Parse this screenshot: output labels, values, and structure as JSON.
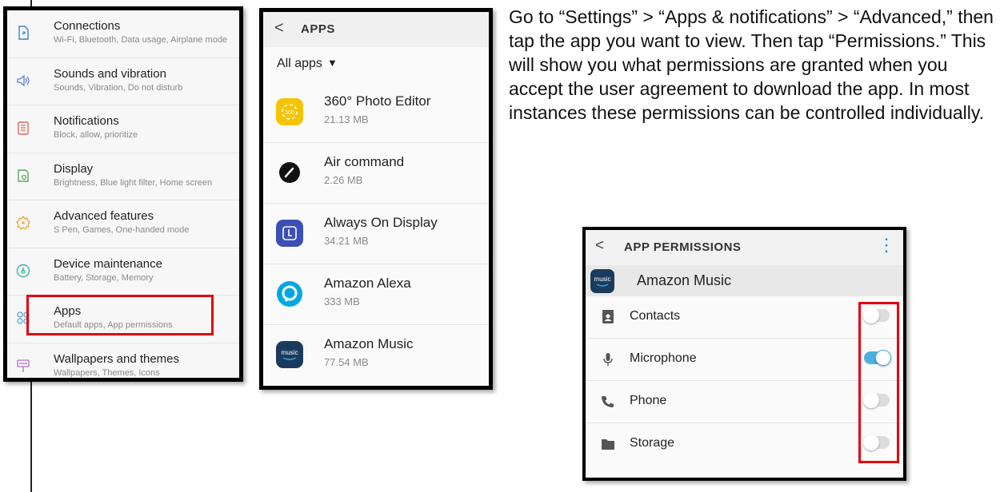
{
  "colors": {
    "highlight": "#e3000f",
    "toggle_on": "#4fb0e0",
    "accent": "#0a8acb"
  },
  "settings": {
    "items": [
      {
        "title": "Connections",
        "subtitle": "Wi-Fi, Bluetooth, Data usage, Airplane mode",
        "icon": "connections-icon"
      },
      {
        "title": "Sounds and vibration",
        "subtitle": "Sounds, Vibration, Do not disturb",
        "icon": "sound-icon"
      },
      {
        "title": "Notifications",
        "subtitle": "Block, allow, prioritize",
        "icon": "notifications-icon"
      },
      {
        "title": "Display",
        "subtitle": "Brightness, Blue light filter, Home screen",
        "icon": "display-icon"
      },
      {
        "title": "Advanced features",
        "subtitle": "S Pen, Games, One-handed mode",
        "icon": "advanced-features-icon"
      },
      {
        "title": "Device maintenance",
        "subtitle": "Battery, Storage, Memory",
        "icon": "device-maintenance-icon"
      },
      {
        "title": "Apps",
        "subtitle": "Default apps, App permissions",
        "icon": "apps-icon"
      },
      {
        "title": "Wallpapers and themes",
        "subtitle": "Wallpapers, Themes, Icons",
        "icon": "wallpapers-icon"
      }
    ]
  },
  "apps_screen": {
    "back": "<",
    "title": "APPS",
    "filter": "All apps",
    "filter_caret": "▼",
    "items": [
      {
        "name": "360° Photo Editor",
        "size": "21.13 MB",
        "icon": "photo-editor-icon"
      },
      {
        "name": "Air command",
        "size": "2.26 MB",
        "icon": "air-command-icon"
      },
      {
        "name": "Always On Display",
        "size": "34.21 MB",
        "icon": "always-on-display-icon"
      },
      {
        "name": "Amazon Alexa",
        "size": "333 MB",
        "icon": "alexa-icon"
      },
      {
        "name": "Amazon Music",
        "size": "77.54 MB",
        "icon": "amazon-music-icon"
      }
    ]
  },
  "instructions": "Go to “Settings” > “Apps & notifications” > “Advanced,” then tap the app you want to view. Then tap “Permissions.” This will show you what permissions are granted when you accept the user agreement to download the app. In most instances these permissions can be controlled individually.",
  "permissions_screen": {
    "back": "<",
    "title": "APP PERMISSIONS",
    "menu": "⋮",
    "app_name": "Amazon Music",
    "app_icon_text": "music",
    "items": [
      {
        "name": "Contacts",
        "enabled": false,
        "icon": "contacts-icon"
      },
      {
        "name": "Microphone",
        "enabled": true,
        "icon": "microphone-icon"
      },
      {
        "name": "Phone",
        "enabled": false,
        "icon": "phone-icon"
      },
      {
        "name": "Storage",
        "enabled": false,
        "icon": "folder-icon"
      }
    ]
  }
}
